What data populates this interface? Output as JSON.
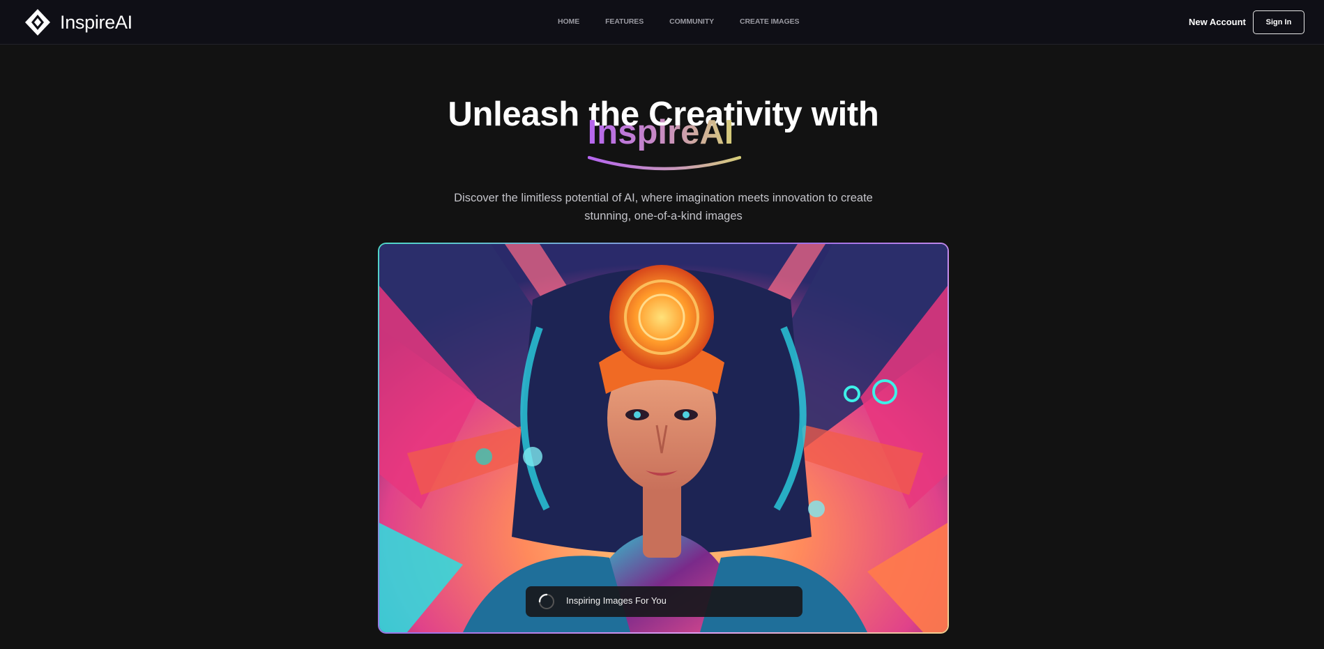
{
  "brand": {
    "name": "InspireAI",
    "logo_icon": "diamond-logo-icon"
  },
  "nav": {
    "links": [
      "HOME",
      "FEATURES",
      "COMMUNITY",
      "CREATE IMAGES"
    ],
    "new_account": "New Account",
    "sign_in": "Sign In"
  },
  "hero": {
    "title": "Unleash the Creativity with",
    "brand_highlight": "InspireAI",
    "description_line1": "Discover the limitless potential of AI, where imagination meets innovation to create",
    "description_line2": "stunning, one-of-a-kind images"
  },
  "showcase": {
    "status_text": "Inspiring Images For You",
    "spinner_icon": "loading-spinner-icon"
  },
  "colors": {
    "background": "#121212",
    "navbar": "#0f0f16",
    "gradient_start": "#b565f0",
    "gradient_end": "#d6cd78"
  }
}
